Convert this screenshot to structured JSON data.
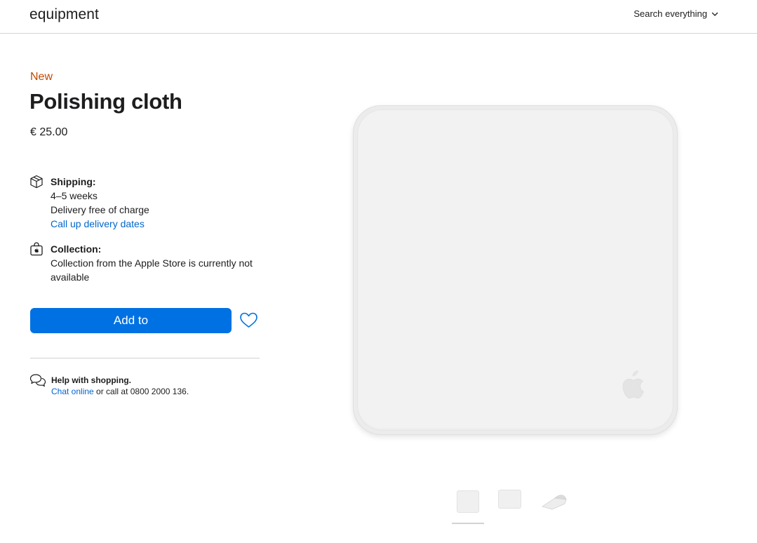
{
  "header": {
    "brand": "equipment",
    "search_label": "Search everything"
  },
  "product": {
    "badge": "New",
    "title": "Polishing cloth",
    "price": "€ 25.00"
  },
  "shipping": {
    "heading": "Shipping:",
    "time": "4–5 weeks",
    "cost": "Delivery free of charge",
    "link": "Call up delivery dates"
  },
  "collection": {
    "heading": "Collection:",
    "text": "Collection from the Apple Store is currently not available"
  },
  "actions": {
    "add_label": "Add to"
  },
  "help": {
    "heading": "Help with shopping.",
    "chat_link": "Chat online",
    "call_text": " or call at 0800 2000 136."
  },
  "colors": {
    "accent": "#0071e3",
    "link": "#0066cc",
    "new_badge": "#bf4800"
  },
  "icons": [
    "chevron-down-icon",
    "box-icon",
    "shopping-bag-icon",
    "heart-icon",
    "chat-bubbles-icon",
    "apple-logo-icon"
  ]
}
